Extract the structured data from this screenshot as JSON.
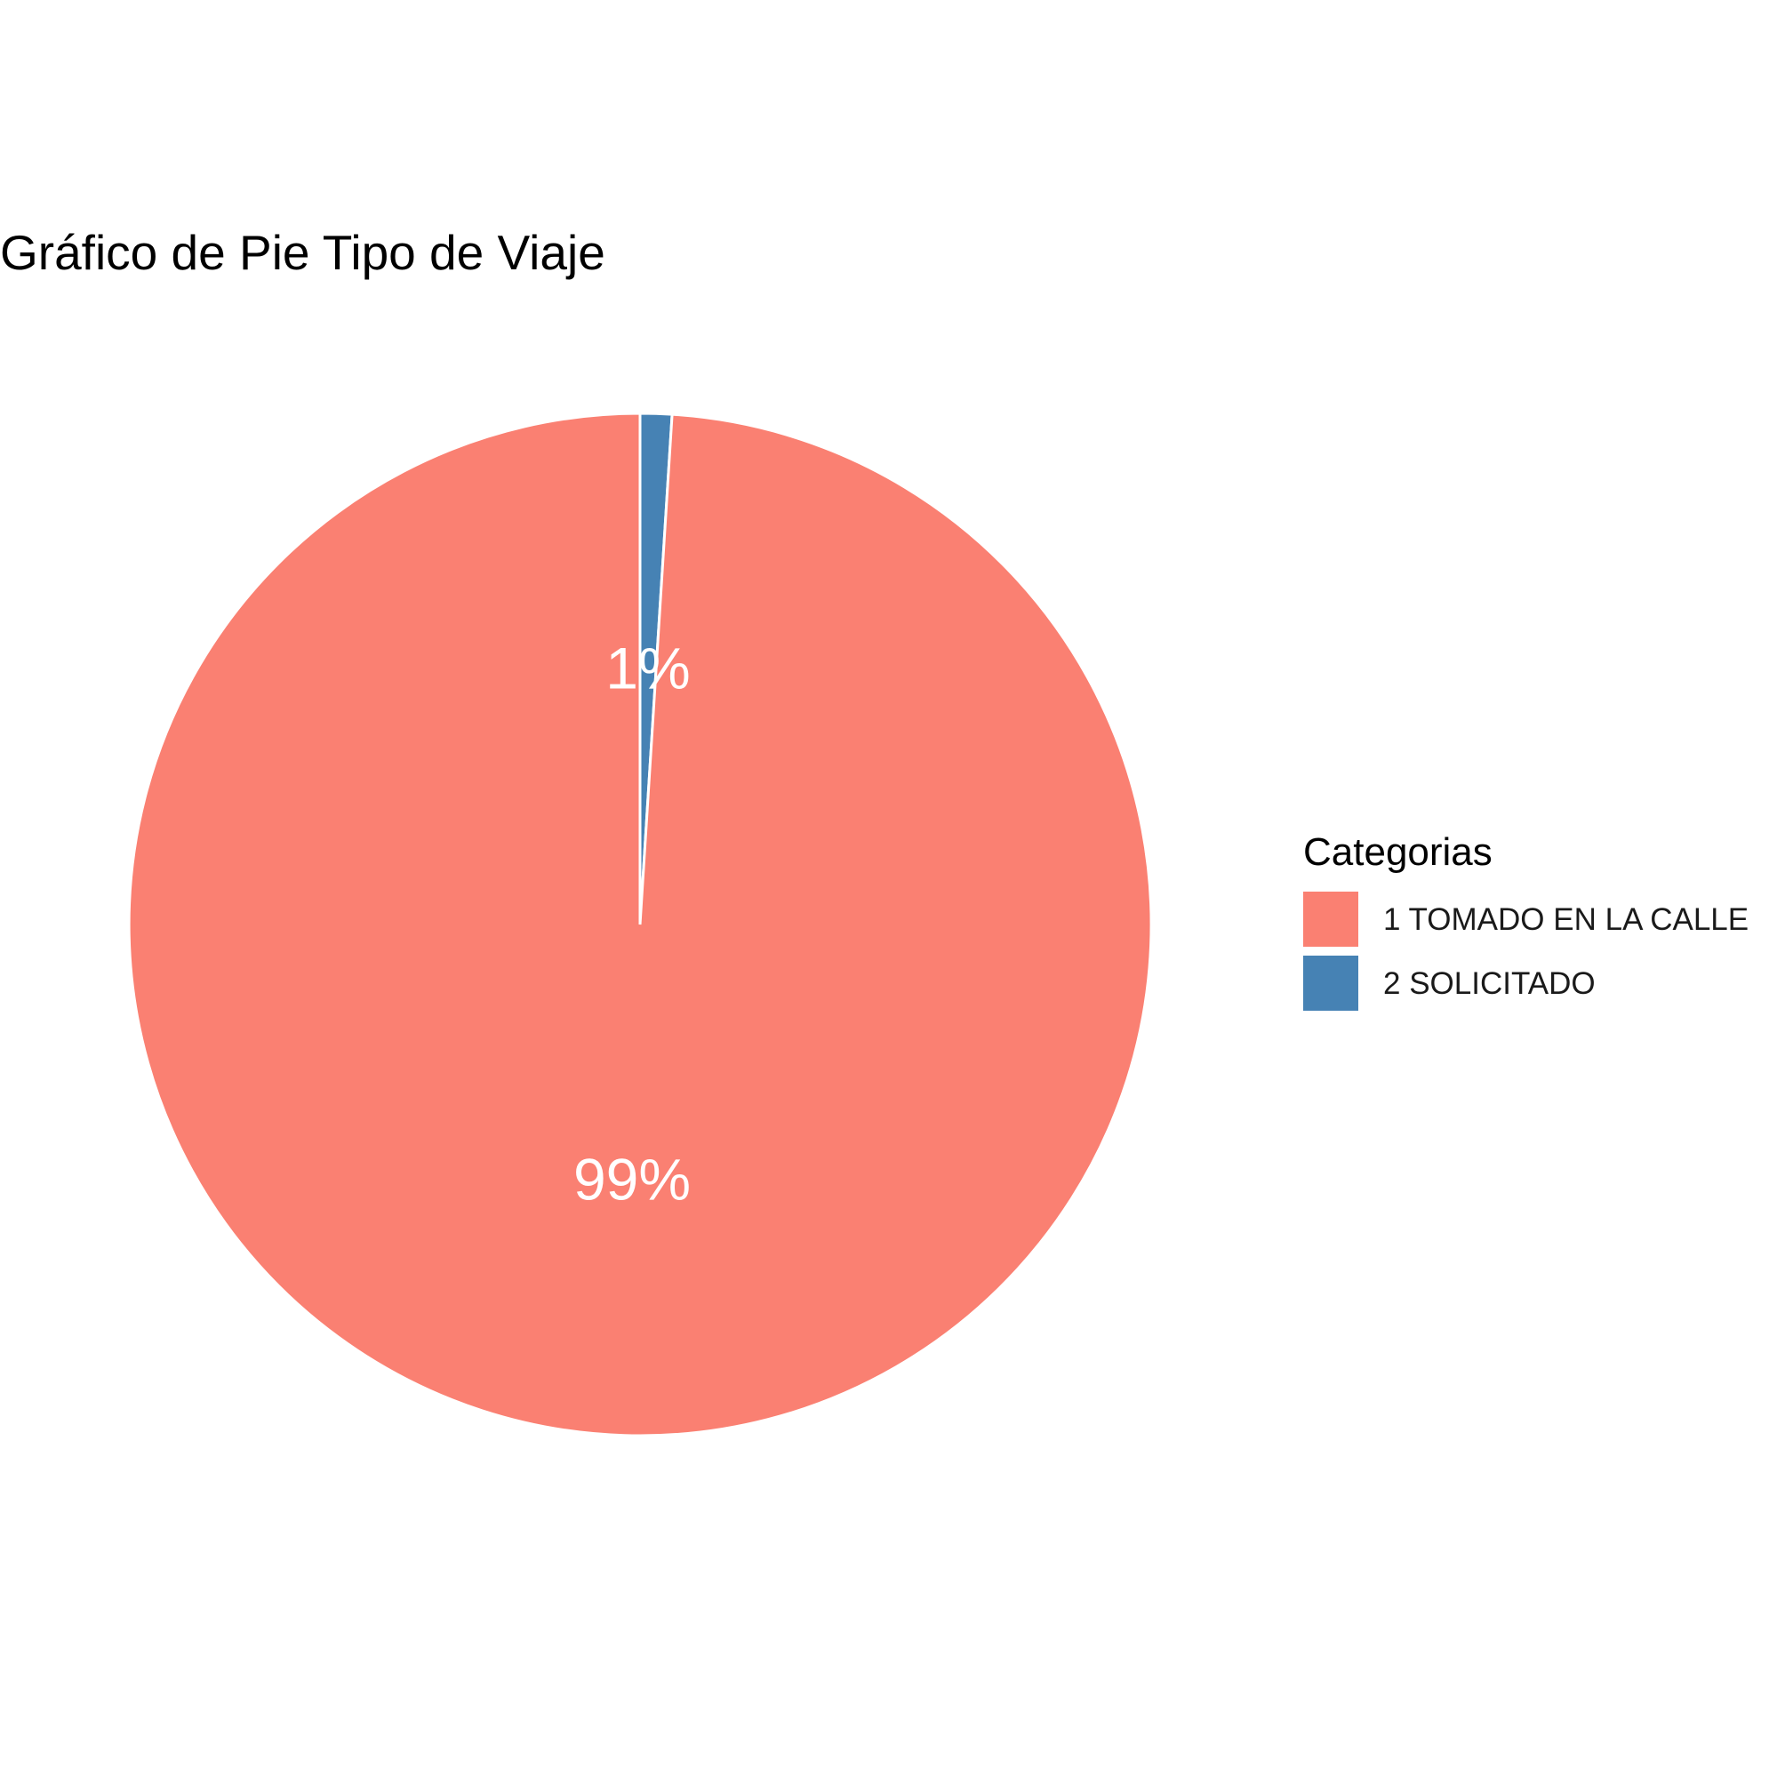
{
  "chart_data": {
    "type": "pie",
    "title": "Gráfico de Pie Tipo de Viaje",
    "legend": {
      "title": "Categorias",
      "placement": "right"
    },
    "slices": [
      {
        "label": "2 SOLICITADO",
        "value": 1,
        "pct_label": "1%",
        "color": "#4682B4"
      },
      {
        "label": "1 TOMADO EN LA CALLE",
        "value": 99,
        "pct_label": "99%",
        "color": "#FA8072"
      }
    ],
    "legend_order": [
      "1 TOMADO EN LA CALLE",
      "2 SOLICITADO"
    ]
  }
}
